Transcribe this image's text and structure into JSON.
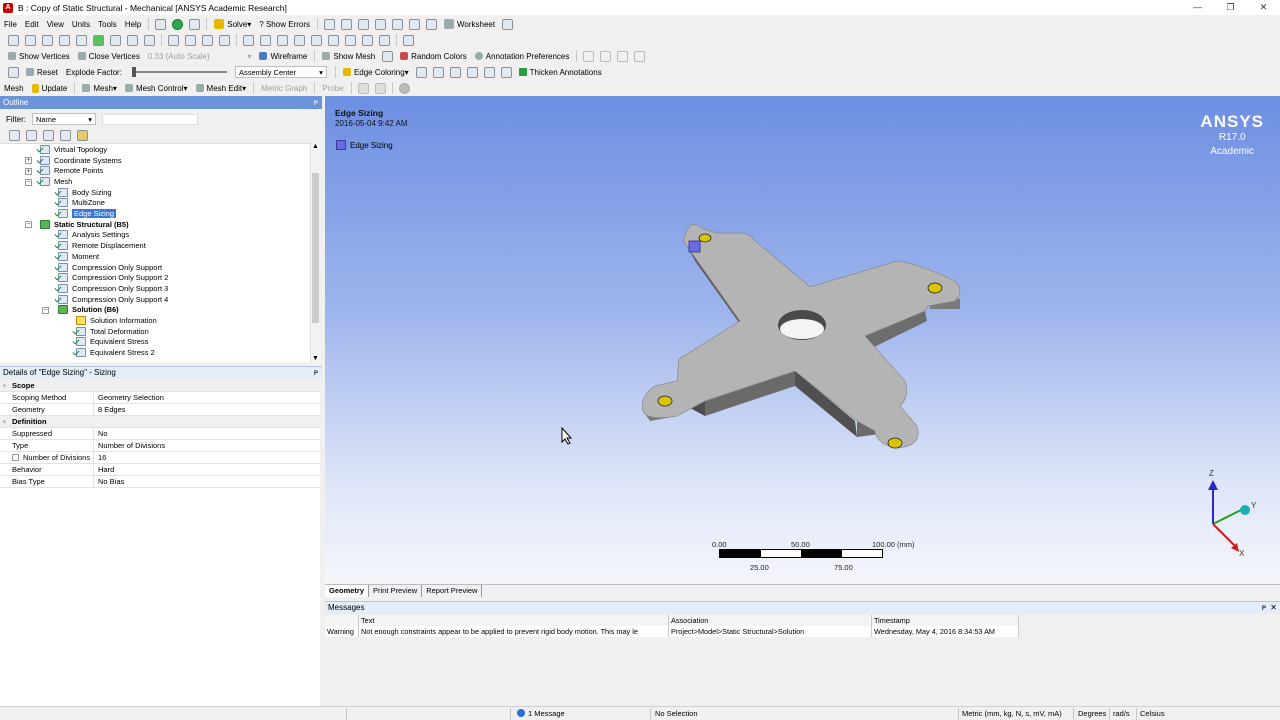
{
  "window": {
    "title": "B : Copy of Static Structural - Mechanical [ANSYS Academic Research]",
    "app_icon": "ansys-icon",
    "controls": [
      "—",
      "❐",
      "✕"
    ]
  },
  "menu": [
    "File",
    "Edit",
    "View",
    "Units",
    "Tools",
    "Help"
  ],
  "toolbar1": {
    "solve": "Solve",
    "show_errors": "? Show Errors",
    "worksheet": "Worksheet"
  },
  "toolbar3": {
    "show_vertices": "Show Vertices",
    "close_vertices": "Close Vertices",
    "auto_scale": "0.33 (Auto Scale)",
    "wireframe": "Wireframe",
    "show_mesh": "Show Mesh",
    "random_colors": "Random Colors",
    "annotation_prefs": "Annotation Preferences"
  },
  "toolbar4": {
    "reset": "Reset",
    "explode_factor": "Explode Factor:",
    "assembly_center": "Assembly Center",
    "edge_coloring": "Edge Coloring",
    "thicken_annotations": "Thicken Annotations"
  },
  "toolbar5": {
    "mesh_label": "Mesh",
    "update": "Update",
    "mesh": "Mesh",
    "mesh_control": "Mesh Control",
    "mesh_edit": "Mesh Edit",
    "metric_graph": "Metric Graph",
    "probe": "Probe"
  },
  "outline": {
    "header": "Outline",
    "filter_label": "Filter:",
    "filter_value": "Name",
    "tree": [
      {
        "label": "Virtual Topology",
        "icon": "check"
      },
      {
        "label": "Coordinate Systems",
        "icon": "check"
      },
      {
        "label": "Remote Points",
        "icon": "check"
      },
      {
        "label": "Mesh",
        "icon": "check"
      },
      {
        "label": "Body Sizing",
        "icon": "check"
      },
      {
        "label": "MultiZone",
        "icon": "check"
      },
      {
        "label": "Edge Sizing",
        "icon": "check"
      },
      {
        "label": "Static Structural (B5)",
        "icon": "struct"
      },
      {
        "label": "Analysis Settings",
        "icon": "check"
      },
      {
        "label": "Remote Displacement",
        "icon": "check"
      },
      {
        "label": "Moment",
        "icon": "check"
      },
      {
        "label": "Compression Only Support",
        "icon": "check"
      },
      {
        "label": "Compression Only Support 2",
        "icon": "check"
      },
      {
        "label": "Compression Only Support 3",
        "icon": "check"
      },
      {
        "label": "Compression Only Support 4",
        "icon": "check"
      },
      {
        "label": "Solution (B6)",
        "icon": "struct"
      },
      {
        "label": "Solution Information",
        "icon": "warn"
      },
      {
        "label": "Total Deformation",
        "icon": "check"
      },
      {
        "label": "Equivalent Stress",
        "icon": "check"
      },
      {
        "label": "Equivalent Stress 2",
        "icon": "check"
      }
    ]
  },
  "details": {
    "header": "Details of \"Edge Sizing\" - Sizing",
    "rows": [
      {
        "k": "Scope",
        "v": "",
        "section": true
      },
      {
        "k": "Scoping Method",
        "v": "Geometry Selection"
      },
      {
        "k": "Geometry",
        "v": "8 Edges"
      },
      {
        "k": "Definition",
        "v": "",
        "section": true
      },
      {
        "k": "Suppressed",
        "v": "No"
      },
      {
        "k": "Type",
        "v": "Number of Divisions"
      },
      {
        "k": "Number of Divisions",
        "v": "16",
        "checkbox": true
      },
      {
        "k": "Behavior",
        "v": "Hard"
      },
      {
        "k": "Bias Type",
        "v": "No Bias"
      }
    ]
  },
  "viewport": {
    "title": "Edge Sizing",
    "date": "2016-05-04 9:42 AM",
    "legend": "Edge Sizing",
    "logo": {
      "l1": "ANSYS",
      "l2": "R17.0",
      "l3": "Academic"
    },
    "scale": {
      "top": [
        "0.00",
        "50.00",
        "100.00 (mm)"
      ],
      "bottom": [
        "25.00",
        "75.00"
      ]
    },
    "triad": {
      "z": "Z",
      "y": "Y",
      "x": "X"
    },
    "colors": {
      "part": "#b4b4b4",
      "legend": "#6a6ae6",
      "bg_top": "#6d8fe2"
    }
  },
  "tabs": [
    "Geometry",
    "Print Preview",
    "Report Preview"
  ],
  "messages": {
    "header": "Messages",
    "columns": [
      "Text",
      "Association",
      "Timestamp"
    ],
    "rows": [
      {
        "type": "Warning",
        "text": "Not enough constraints appear to be applied to prevent rigid body motion.  This may le",
        "association": "Project>Model>Static Structural>Solution",
        "timestamp": "Wednesday, May 4, 2016 8:34:53 AM"
      }
    ]
  },
  "status": {
    "messages": "1 Message",
    "selection": "No Selection",
    "units": "Metric (mm, kg, N, s, mV, mA)",
    "angle": "Degrees",
    "rate": "rad/s",
    "temp": "Celsius"
  }
}
